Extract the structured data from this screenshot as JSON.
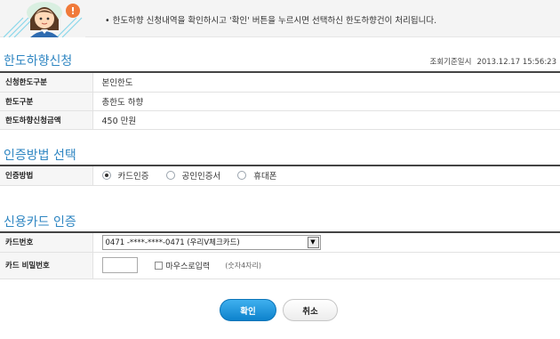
{
  "notice": {
    "text": "• 한도하향 신청내역을 확인하시고 '확인' 버튼을 누르시면 선택하신 한도하향건이 처리됩니다."
  },
  "limit_section": {
    "title": "한도하향신청",
    "query_time_label": "조회기준일시",
    "query_time": "2013.12.17 15:56:23",
    "rows": [
      {
        "label": "신청한도구분",
        "value": "본인한도"
      },
      {
        "label": "한도구분",
        "value": "총한도 하향"
      },
      {
        "label": "한도하향신청금액",
        "value": "450 만원"
      }
    ]
  },
  "auth_section": {
    "title": "인증방법 선택",
    "label": "인증방법",
    "options": [
      {
        "label": "카드인증",
        "selected": true
      },
      {
        "label": "공인인증서",
        "selected": false
      },
      {
        "label": "휴대폰",
        "selected": false
      }
    ]
  },
  "card_section": {
    "title": "신용카드 인증",
    "card_number_label": "카드번호",
    "card_number_value": "0471 -****-****-0471 (우리V체크카드)",
    "password_label": "카드 비밀번호",
    "mouse_input_label": "마우스로입력",
    "password_hint": "(숫자4자리)"
  },
  "buttons": {
    "confirm": "확인",
    "cancel": "취소"
  },
  "colors": {
    "accent": "#2f86c2",
    "confirm_button": "#1a8fd6",
    "warning_icon": "#f07a3a"
  }
}
